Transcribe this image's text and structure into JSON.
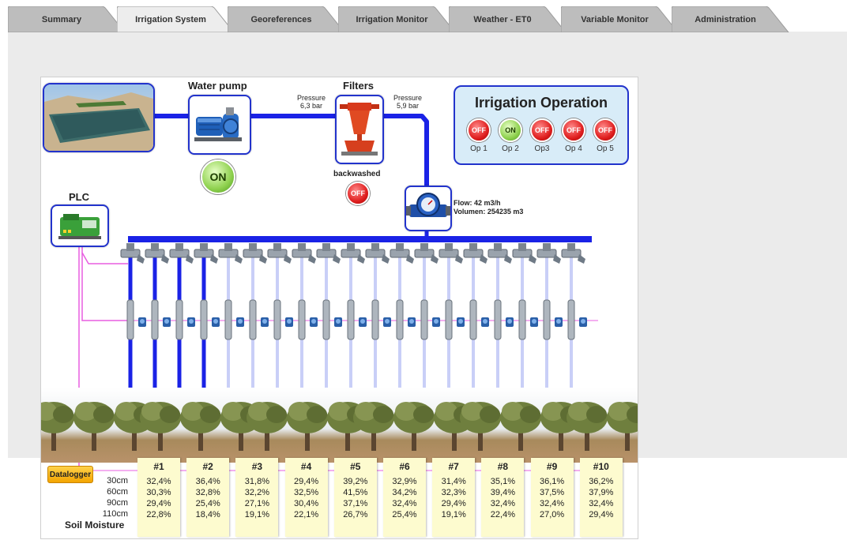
{
  "tabs": [
    {
      "label": "Summary",
      "active": false
    },
    {
      "label": "Irrigation System",
      "active": true
    },
    {
      "label": "Georeferences",
      "active": false
    },
    {
      "label": "Irrigation Monitor",
      "active": false
    },
    {
      "label": "Weather - ET0",
      "active": false
    },
    {
      "label": "Variable Monitor",
      "active": false
    },
    {
      "label": "Administration",
      "active": false
    }
  ],
  "pump": {
    "title": "Water pump",
    "state": "ON"
  },
  "filters": {
    "title": "Filters",
    "backwash_label": "backwashed",
    "backwash_state": "OFF"
  },
  "pressure_in": {
    "label": "Pressure",
    "value": "6,3 bar"
  },
  "pressure_out": {
    "label": "Pressure",
    "value": "5,9 bar"
  },
  "meter": {
    "flow": "Flow:  42 m3/h",
    "volume": "Volumen: 254235 m3"
  },
  "plc": {
    "label": "PLC"
  },
  "operation": {
    "title": "Irrigation Operation",
    "items": [
      {
        "label": "Op 1",
        "state": "OFF"
      },
      {
        "label": "Op 2",
        "state": "ON"
      },
      {
        "label": "Op3",
        "state": "OFF"
      },
      {
        "label": "Op 4",
        "state": "OFF"
      },
      {
        "label": "Op 5",
        "state": "OFF"
      }
    ]
  },
  "valves": {
    "count": 19,
    "active_count": 4
  },
  "datalogger": {
    "label": "Datalogger"
  },
  "soil": {
    "title": "Soil Moisture",
    "depths": [
      "30cm",
      "60cm",
      "90cm",
      "110cm"
    ],
    "sensors": [
      {
        "id": "#1",
        "values": [
          "32,4%",
          "30,3%",
          "29,4%",
          "22,8%"
        ]
      },
      {
        "id": "#2",
        "values": [
          "36,4%",
          "32,8%",
          "25,4%",
          "18,4%"
        ]
      },
      {
        "id": "#3",
        "values": [
          "31,8%",
          "32,2%",
          "27,1%",
          "19,1%"
        ]
      },
      {
        "id": "#4",
        "values": [
          "29,4%",
          "32,5%",
          "30,4%",
          "22,1%"
        ]
      },
      {
        "id": "#5",
        "values": [
          "39,2%",
          "41,5%",
          "37,1%",
          "26,7%"
        ]
      },
      {
        "id": "#6",
        "values": [
          "32,9%",
          "34,2%",
          "32,4%",
          "25,4%"
        ]
      },
      {
        "id": "#7",
        "values": [
          "31,4%",
          "32,3%",
          "29,4%",
          "19,1%"
        ]
      },
      {
        "id": "#8",
        "values": [
          "35,1%",
          "39,4%",
          "32,4%",
          "22,4%"
        ]
      },
      {
        "id": "#9",
        "values": [
          "36,1%",
          "37,5%",
          "32,4%",
          "27,0%"
        ]
      },
      {
        "id": "#10",
        "values": [
          "36,2%",
          "37,9%",
          "32,4%",
          "29,4%"
        ]
      }
    ]
  },
  "colors": {
    "pipe": "#1a22e6",
    "pipe_light": "#c9cff7",
    "cable": "#e85fe0",
    "off": "#e02020",
    "on": "#8fd14f",
    "panel": "#d8ecf8",
    "sensor_bg": "#fdfbcf"
  }
}
